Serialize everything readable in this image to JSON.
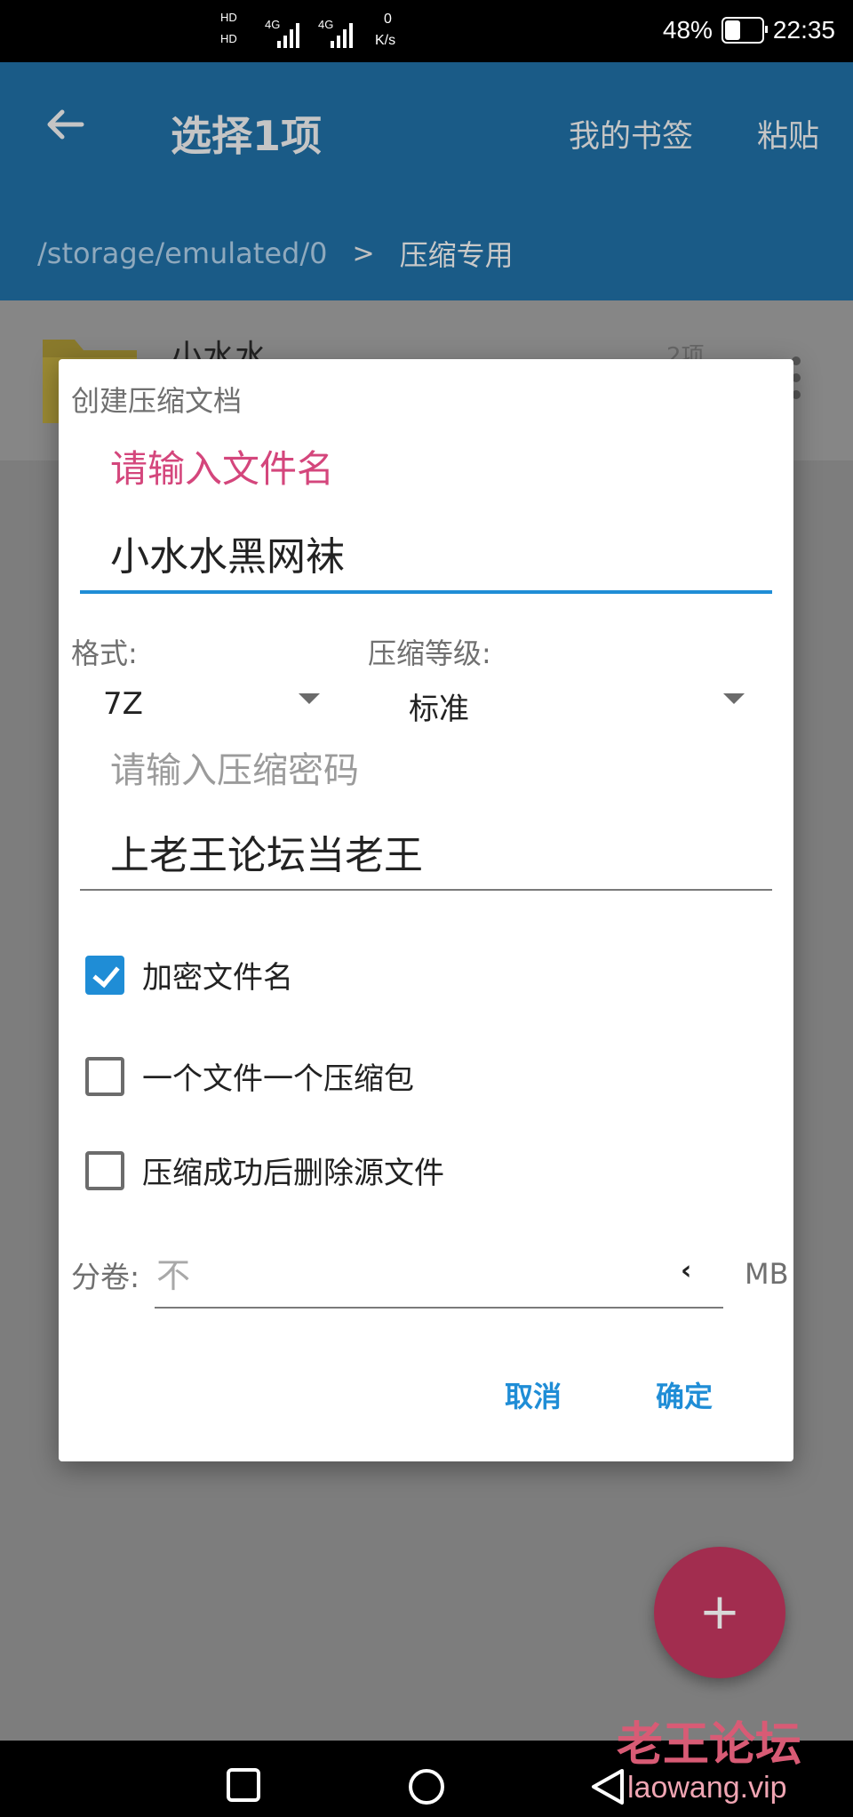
{
  "status_bar": {
    "hd1": "HD",
    "hd2": "HD",
    "net1": "4G",
    "net2": "4G",
    "speed": "0",
    "speed_unit": "K/s",
    "battery_level": 0.48,
    "battery_text": "48%",
    "time": "22:35"
  },
  "app_bar": {
    "title": "选择1项",
    "bookmarks_label": "我的书签",
    "paste_label": "粘贴"
  },
  "breadcrumb": {
    "path": "/storage/emulated/0",
    "separator": ">",
    "current": "压缩专用"
  },
  "file_list": [
    {
      "name": "小水水",
      "count": "2项"
    }
  ],
  "dialog": {
    "title": "创建压缩文档",
    "filename_label": "请输入文件名",
    "filename_value": "小水水黑网袜",
    "format_label": "格式:",
    "format_value": "7Z",
    "level_label": "压缩等级:",
    "level_value": "标准",
    "password_label": "请输入压缩密码",
    "password_value": "上老王论坛当老王",
    "options": [
      {
        "label": "加密文件名",
        "checked": true
      },
      {
        "label": "一个文件一个压缩包",
        "checked": false
      },
      {
        "label": "压缩成功后删除源文件",
        "checked": false
      }
    ],
    "split_label": "分卷:",
    "split_placeholder": "不",
    "split_unit": "MB",
    "cancel_label": "取消",
    "ok_label": "确定"
  },
  "fab_label": "+",
  "watermark": {
    "line1": "老王论坛",
    "line2": "laowang.vip"
  },
  "colors": {
    "accent": "#1f8dd6",
    "label_pink": "#d4467c",
    "app_bar": "#1a5b87",
    "fab": "#a22d4f"
  }
}
